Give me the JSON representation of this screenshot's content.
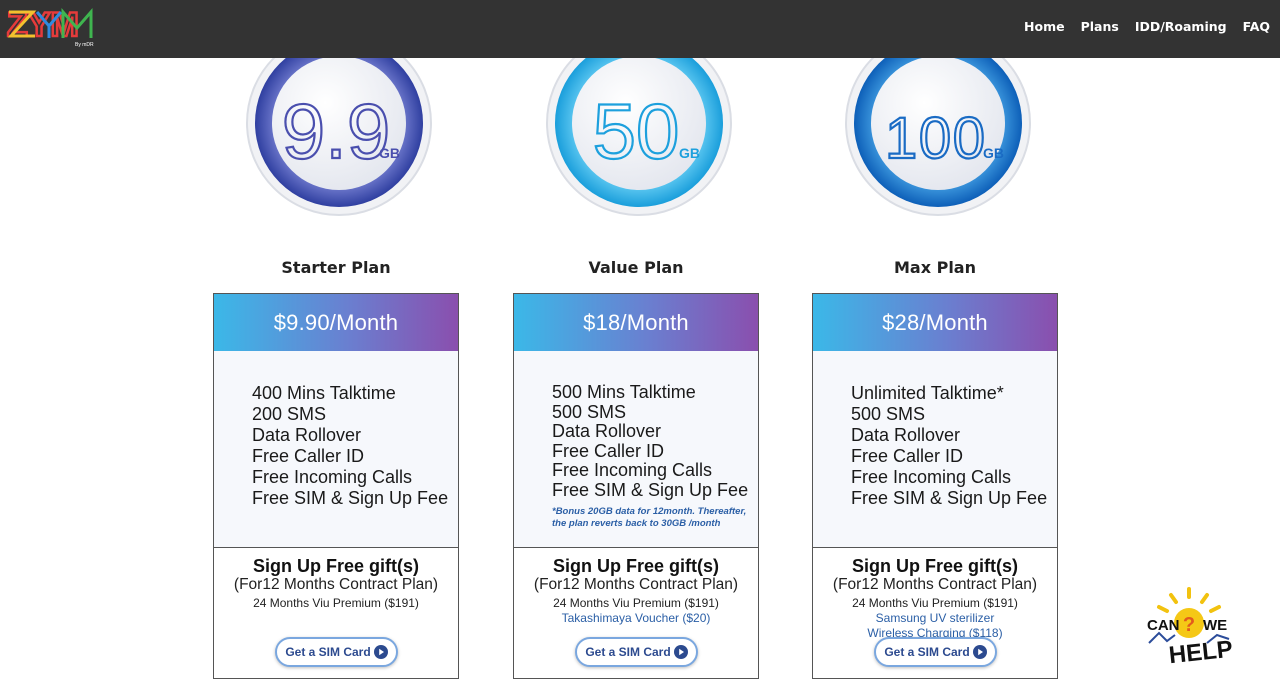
{
  "brand": {
    "logo_text": "ZYM",
    "logo_sub": "By mDR"
  },
  "nav": {
    "items": [
      {
        "label": "Home"
      },
      {
        "label": "Plans"
      },
      {
        "label": "IDD/Roaming"
      },
      {
        "label": "FAQ"
      }
    ]
  },
  "plans": [
    {
      "badge_value": "9.9",
      "badge_unit": "GB",
      "badge_colors": {
        "ring_inner": "#7f88d8",
        "ring_outer": "#2f3fa0",
        "text": "#4a4fae"
      },
      "title": "Starter Plan",
      "price": "$9.90/Month",
      "features": [
        "400 Mins Talktime",
        "200 SMS",
        "Data Rollover",
        "Free Caller ID",
        "Free Incoming Calls",
        "Free SIM & Sign Up Fee"
      ],
      "gift_title": "Sign Up Free gift(s)",
      "gift_subtitle": "(For12 Months Contract Plan)",
      "gift_items": [
        "24 Months Viu Premium ($191)"
      ],
      "cta_label": "Get a SIM Card"
    },
    {
      "badge_value": "50",
      "badge_unit": "GB",
      "badge_colors": {
        "ring_inner": "#6fd3f7",
        "ring_outer": "#1a9edb",
        "text": "#1da0dd"
      },
      "title": "Value Plan",
      "price": "$18/Month",
      "features": [
        "500 Mins Talktime",
        "500 SMS",
        "Data Rollover",
        "Free Caller ID",
        "Free Incoming Calls",
        "Free SIM & Sign Up Fee"
      ],
      "bonus_note": "*Bonus 20GB data for 12month. Thereafter, the plan reverts back to 30GB /month",
      "gift_title": "Sign Up Free gift(s)",
      "gift_subtitle": "(For12 Months Contract Plan)",
      "gift_items": [
        "24 Months Viu Premium ($191)",
        "Takashimaya Voucher ($20)"
      ],
      "cta_label": "Get a SIM Card"
    },
    {
      "badge_value": "100",
      "badge_unit": "GB",
      "badge_colors": {
        "ring_inner": "#4aa7e8",
        "ring_outer": "#0d5fb8",
        "text": "#1a6bc4"
      },
      "title": "Max Plan",
      "price": "$28/Month",
      "features": [
        "Unlimited Talktime*",
        "500 SMS",
        "Data Rollover",
        "Free Caller ID",
        "Free Incoming Calls",
        "Free SIM & Sign Up Fee"
      ],
      "gift_title": "Sign Up Free gift(s)",
      "gift_subtitle": "(For12 Months Contract Plan)",
      "gift_items": [
        "24 Months Viu Premium ($191)",
        "Samsung UV sterilizer",
        "Wireless Charging ($118)"
      ],
      "cta_label": "Get a SIM Card"
    }
  ],
  "help_widget": {
    "line1_left": "CAN",
    "line1_right": "WE",
    "line2": "HELP",
    "mark": "?"
  }
}
